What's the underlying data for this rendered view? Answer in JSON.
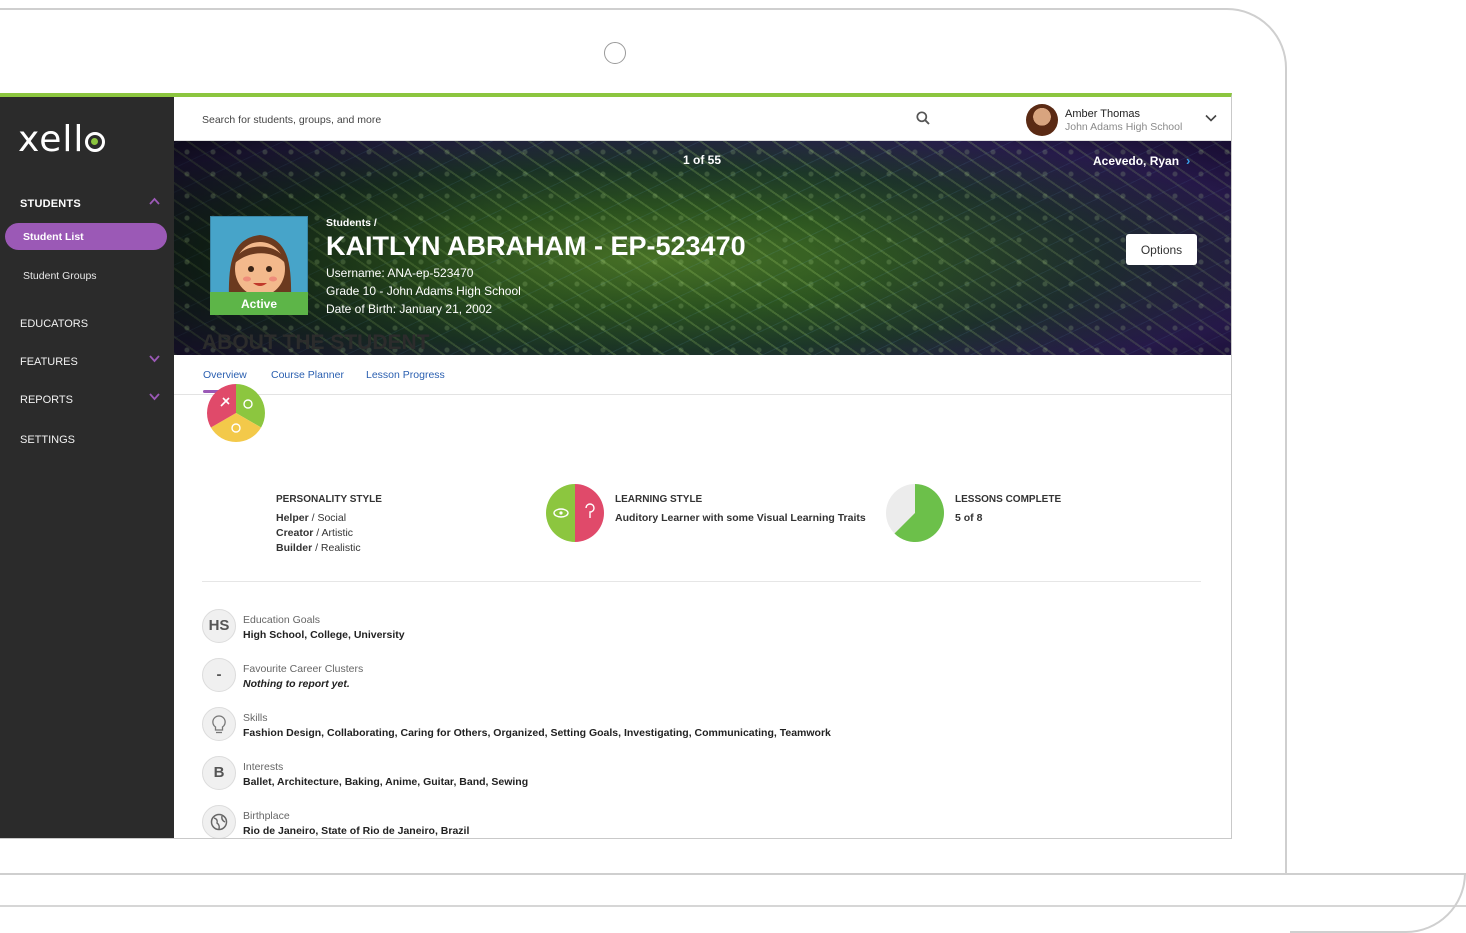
{
  "topbar": {
    "search_placeholder": "Search for students, groups, and more",
    "user": {
      "name": "Amber Thomas",
      "school": "John Adams High School"
    }
  },
  "sidebar": {
    "logo": "xello",
    "students_label": "STUDENTS",
    "student_list": "Student List",
    "student_groups": "Student Groups",
    "educators": "EDUCATORS",
    "features": "FEATURES",
    "reports": "REPORTS",
    "settings": "SETTINGS"
  },
  "hero": {
    "pager": "1 of 55",
    "next_student": "Acevedo, Ryan",
    "breadcrumb": "Students /",
    "student_name": "KAITLYN ABRAHAM",
    "student_id": " - EP-523470",
    "username": "Username: ANA-ep-523470",
    "grade": "Grade 10 - John Adams High School",
    "dob": "Date of Birth: January 21, 2002",
    "status": "Active",
    "options_label": "Options"
  },
  "tabs": [
    {
      "label": "Overview",
      "active": true
    },
    {
      "label": "Course Planner",
      "active": false
    },
    {
      "label": "Lesson Progress",
      "active": false
    }
  ],
  "about": {
    "title_bold": "ABOUT",
    "title_rest": " THE STUDENT",
    "personality": {
      "heading": "PERSONALITY STYLE",
      "lines": [
        {
          "primary": "Helper",
          "secondary": " / Social"
        },
        {
          "primary": "Creator",
          "secondary": " / Artistic"
        },
        {
          "primary": "Builder",
          "secondary": " / Realistic"
        }
      ]
    },
    "learning": {
      "heading": "LEARNING STYLE",
      "text": "Auditory Learner with some Visual Learning Traits"
    },
    "lessons": {
      "heading": "LESSONS COMPLETE",
      "text": "5 of 8",
      "completed": 5,
      "total": 8
    }
  },
  "info": [
    {
      "icon": "HS",
      "label": "Education Goals",
      "value": "High School, College, University"
    },
    {
      "icon": "-",
      "label": "Favourite Career Clusters",
      "value": "Nothing to report yet."
    },
    {
      "icon": "lightbulb",
      "label": "Skills",
      "value": "Fashion Design, Collaborating, Caring for Others, Organized, Setting Goals, Investigating, Communicating, Teamwork"
    },
    {
      "icon": "B",
      "label": "Interests",
      "value": "Ballet, Architecture, Baking, Anime, Guitar, Band, Sewing"
    },
    {
      "icon": "globe",
      "label": "Birthplace",
      "value": "Rio de Janeiro, State of Rio de Janeiro, Brazil"
    }
  ],
  "colors": {
    "accent_purple": "#9b59b6",
    "accent_green": "#8cc63f",
    "sidebar_bg": "#2b2b2b",
    "link_blue": "#2a5fb0"
  }
}
